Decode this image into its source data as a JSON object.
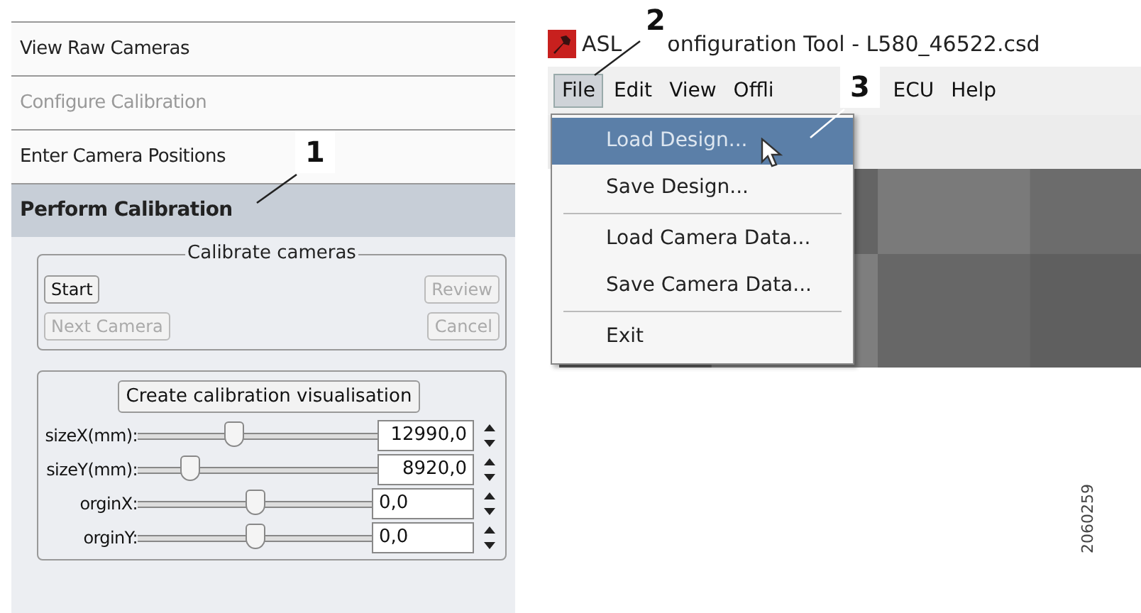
{
  "sidebar": {
    "tabs": [
      {
        "label": "View Raw Cameras",
        "selected": false,
        "disabled": false
      },
      {
        "label": "Configure Calibration",
        "selected": false,
        "disabled": true
      },
      {
        "label": "Enter Camera Positions",
        "selected": false,
        "disabled": false
      },
      {
        "label": "Perform Calibration",
        "selected": true,
        "disabled": false
      }
    ]
  },
  "calibrate_group": {
    "title": "Calibrate cameras",
    "buttons": [
      {
        "label": "Start",
        "disabled": false
      },
      {
        "label": "Review",
        "disabled": true
      },
      {
        "label": "Next Camera",
        "disabled": true
      },
      {
        "label": "Cancel",
        "disabled": true
      }
    ]
  },
  "visualisation_group": {
    "button": "Create calibration visualisation",
    "rows": [
      {
        "label": "sizeX(mm):",
        "level": 0.4,
        "value": "12990,0"
      },
      {
        "label": "sizeY(mm):",
        "level": 0.22,
        "value": "8920,0"
      },
      {
        "label": "orginX:",
        "level": 0.5,
        "value": "0,0"
      },
      {
        "label": "orginY:",
        "level": 0.5,
        "value": "0,0"
      }
    ]
  },
  "window": {
    "title_start": "ASL",
    "title_end": "onfiguration Tool - L580_46522.csd",
    "menu": [
      {
        "label": "File",
        "selected": true
      },
      {
        "label": "Edit",
        "selected": false
      },
      {
        "label": "View",
        "selected": false
      },
      {
        "label": "Offli",
        "selected": false
      },
      {
        "label": "ECU",
        "selected": false
      },
      {
        "label": "Help",
        "selected": false
      }
    ],
    "file_menu": [
      {
        "label": "Load Design...",
        "selected": true,
        "separator_after": false
      },
      {
        "label": "Save Design...",
        "selected": false,
        "separator_after": true
      },
      {
        "label": "Load Camera Data...",
        "selected": false,
        "separator_after": false
      },
      {
        "label": "Save Camera Data...",
        "selected": false,
        "separator_after": true
      },
      {
        "label": "Exit",
        "selected": false,
        "separator_after": false
      }
    ]
  },
  "callouts": [
    "1",
    "2",
    "3"
  ],
  "figure_code": "2060259"
}
